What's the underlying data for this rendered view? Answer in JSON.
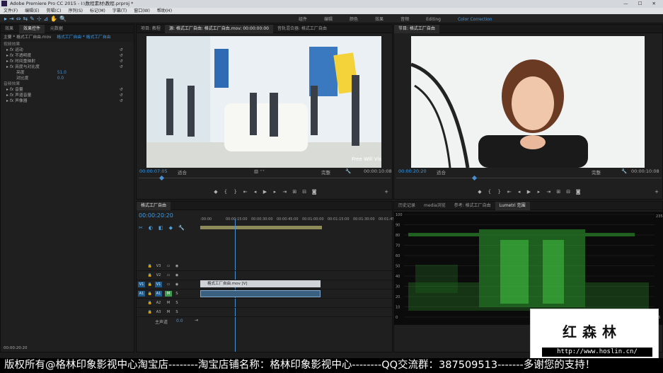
{
  "app": {
    "title": "Adobe Premiere Pro CC 2015 - I:\\数程素材\\教程.prproj *",
    "menu": [
      "文件(F)",
      "编辑(E)",
      "剪辑(C)",
      "序列(S)",
      "标记(M)",
      "字幕(T)",
      "窗口(W)",
      "帮助(H)"
    ],
    "workspaces": [
      "组件",
      "编辑",
      "颜色",
      "效果",
      "音频",
      "Editing",
      "Color Correction"
    ],
    "active_workspace": "Color Correction"
  },
  "effects_panel": {
    "tabs": [
      "效果",
      "效果控件",
      "元数据"
    ],
    "active_tab": "效果控件",
    "header_clip": "主要 * 格式工厂自由.mov",
    "header_seq": "格式工厂自由 * 格式工厂自由",
    "sections": {
      "video": "视频效果",
      "audio": "音频效果"
    },
    "video_effects": [
      "运动",
      "不透明度",
      "时间重映射",
      "亮度与对比度"
    ],
    "brightness_label": "亮度",
    "brightness_value": "51.0",
    "contrast_label": "对比度",
    "contrast_value": "0.0",
    "audio_effects": [
      "音量",
      "声道音量",
      "声像器"
    ],
    "timecode": "00:00:20:20"
  },
  "source_monitor": {
    "tabs": [
      "项目: 教程",
      "源: 格式工厂自由: 格式工厂自由.mov: 00:00:00:00",
      "音轨混合器: 格式工厂自由"
    ],
    "timecode": "00:00:07:05",
    "fit": "适合",
    "quality": "完整",
    "duration": "00:00:10:08",
    "video_caption": "Free Will Visual"
  },
  "program_monitor": {
    "tab": "节目: 格式工厂自由",
    "timecode": "00:00:20:20",
    "fit": "适合",
    "quality": "完整",
    "duration": "00:00:10:08"
  },
  "timeline": {
    "tab": "格式工厂自由",
    "timecode": "00:00:20:20",
    "ruler": [
      ":00:00",
      "00:00:15:00",
      "00:00:30:00",
      "00:00:45:00",
      "00:01:00:00",
      "00:01:15:00",
      "00:01:30:00",
      "00:01:45:"
    ],
    "tracks": [
      {
        "src": "",
        "name": "V3",
        "type": "video"
      },
      {
        "src": "",
        "name": "V2",
        "type": "video"
      },
      {
        "src": "V1",
        "name": "V1",
        "type": "video"
      },
      {
        "src": "A1",
        "name": "A1",
        "type": "audio"
      },
      {
        "src": "",
        "name": "A2",
        "type": "audio"
      },
      {
        "src": "",
        "name": "A3",
        "type": "audio"
      }
    ],
    "master_label": "主声道",
    "master_value": "0.0",
    "clip_label": "格式工厂自由.mov [V]",
    "m_label": "M",
    "s_label": "S"
  },
  "scopes_panel": {
    "tabs": [
      "历史记录",
      "media浏览",
      "参考: 格式工厂自由",
      "Lumetri 范围"
    ],
    "active_tab": "Lumetri 范围",
    "left_axis": [
      "100",
      "90",
      "80",
      "70",
      "60",
      "50",
      "40",
      "30",
      "20",
      "10",
      "0"
    ],
    "right_axis": [
      "235",
      "16"
    ]
  },
  "overlay": {
    "bottom_banner": "版权所有@格林印象影视中心淘宝店--------淘宝店铺名称：格林印象影视中心--------QQ交流群：387509513-------多谢您的支持！",
    "logo_text": "红森林",
    "logo_url": "http://www.hoslin.cn/"
  },
  "colors": {
    "accent_blue": "#3a9bea",
    "playhead": "#4b8fd1",
    "waveform_green": "#2fa32f"
  }
}
